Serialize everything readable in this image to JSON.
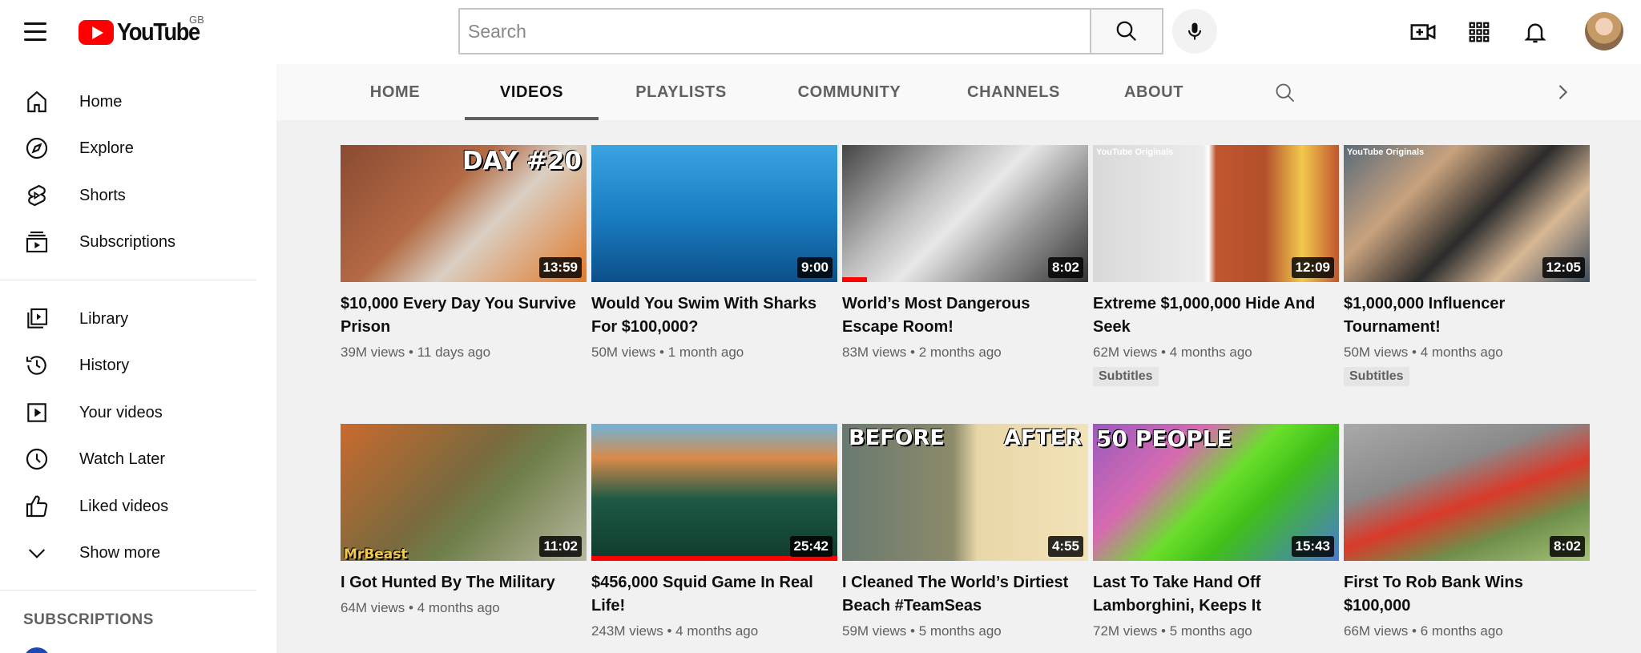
{
  "masthead": {
    "logo_text": "YouTube",
    "country": "GB",
    "search_placeholder": "Search"
  },
  "sidebar": {
    "items": [
      {
        "label": "Home",
        "icon": "home-icon"
      },
      {
        "label": "Explore",
        "icon": "compass-icon"
      },
      {
        "label": "Shorts",
        "icon": "shorts-icon"
      },
      {
        "label": "Subscriptions",
        "icon": "subscriptions-icon"
      },
      {
        "label": "Library",
        "icon": "library-icon"
      },
      {
        "label": "History",
        "icon": "history-icon"
      },
      {
        "label": "Your videos",
        "icon": "your-videos-icon"
      },
      {
        "label": "Watch Later",
        "icon": "watch-later-icon"
      },
      {
        "label": "Liked videos",
        "icon": "thumbs-up-icon"
      },
      {
        "label": "Show more",
        "icon": "chevron-down-icon"
      }
    ],
    "subscriptions_heading": "SUBSCRIPTIONS"
  },
  "tabs": [
    {
      "label": "HOME"
    },
    {
      "label": "VIDEOS"
    },
    {
      "label": "PLAYLISTS"
    },
    {
      "label": "COMMUNITY"
    },
    {
      "label": "CHANNELS"
    },
    {
      "label": "ABOUT"
    }
  ],
  "videos": [
    {
      "title": "$10,000 Every Day You Survive Prison",
      "views": "39M views",
      "age": "11 days ago",
      "duration": "13:59",
      "overlay": "DAY #20"
    },
    {
      "title": "Would You Swim With Sharks For $100,000?",
      "views": "50M views",
      "age": "1 month ago",
      "duration": "9:00"
    },
    {
      "title": "World’s Most Dangerous Escape Room!",
      "views": "83M views",
      "age": "2 months ago",
      "duration": "8:02",
      "watched": 0.1
    },
    {
      "title": "Extreme $1,000,000 Hide And Seek",
      "views": "62M views",
      "age": "4 months ago",
      "duration": "12:09",
      "badge": "Subtitles",
      "originals": "YouTube Originals"
    },
    {
      "title": "$1,000,000 Influencer Tournament!",
      "views": "50M views",
      "age": "4 months ago",
      "duration": "12:05",
      "badge": "Subtitles",
      "originals": "YouTube Originals"
    },
    {
      "title": "I Got Hunted By The Military",
      "views": "64M views",
      "age": "4 months ago",
      "duration": "11:02",
      "overlay": "MrBeast"
    },
    {
      "title": "$456,000 Squid Game In Real Life!",
      "views": "243M views",
      "age": "4 months ago",
      "duration": "25:42",
      "watched": 1.0
    },
    {
      "title": "I Cleaned The World’s Dirtiest Beach #TeamSeas",
      "views": "59M views",
      "age": "5 months ago",
      "duration": "4:55",
      "overlay_left": "BEFORE",
      "overlay_right": "AFTER"
    },
    {
      "title": "Last To Take Hand Off Lamborghini, Keeps It",
      "views": "72M views",
      "age": "5 months ago",
      "duration": "15:43",
      "overlay": "50 PEOPLE"
    },
    {
      "title": "First To Rob Bank Wins $100,000",
      "views": "66M views",
      "age": "6 months ago",
      "duration": "8:02"
    }
  ]
}
